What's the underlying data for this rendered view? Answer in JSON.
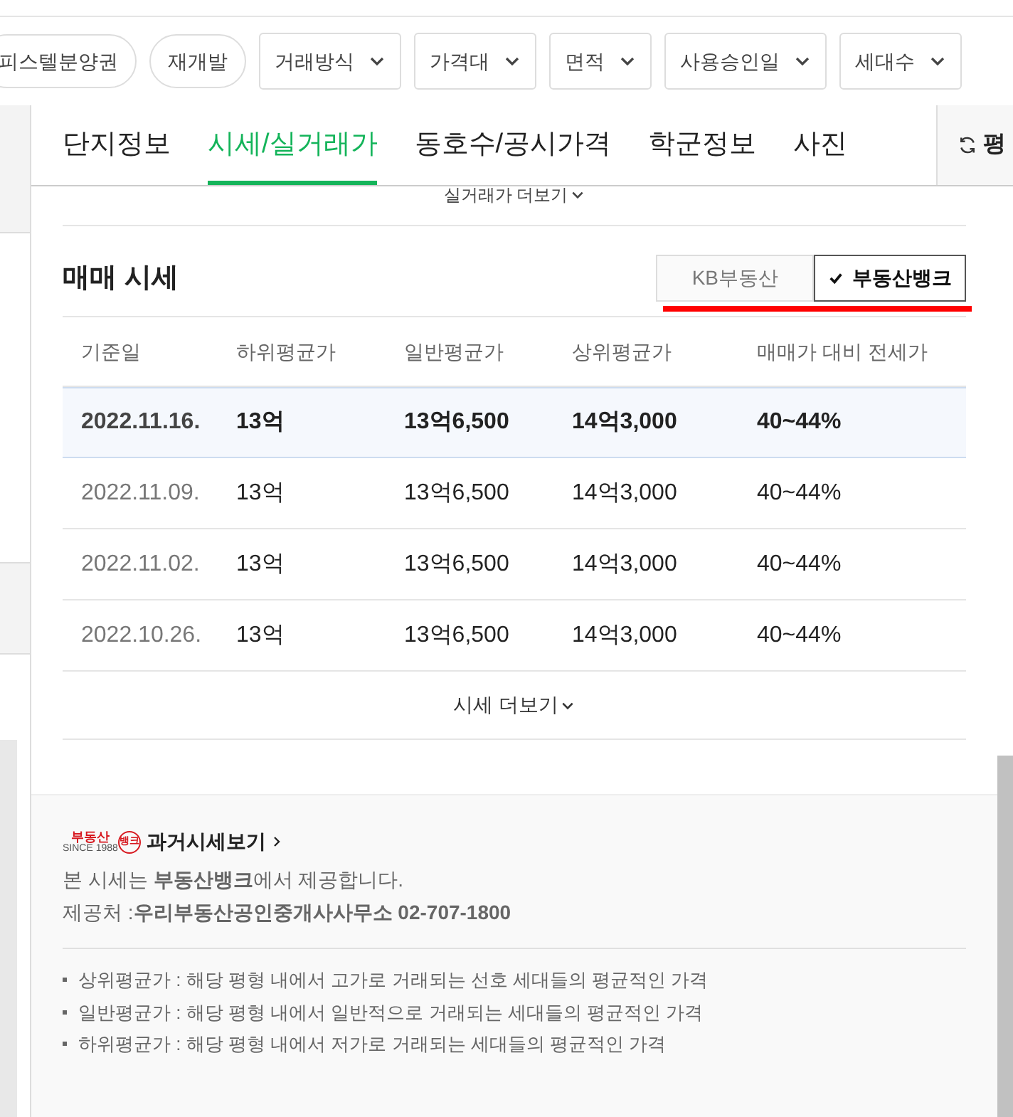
{
  "filters": [
    {
      "label": "피스텔분양권",
      "kind": "chip"
    },
    {
      "label": "재개발",
      "kind": "chip"
    },
    {
      "label": "거래방식",
      "kind": "dropdown"
    },
    {
      "label": "가격대",
      "kind": "dropdown"
    },
    {
      "label": "면적",
      "kind": "dropdown"
    },
    {
      "label": "사용승인일",
      "kind": "dropdown"
    },
    {
      "label": "세대수",
      "kind": "dropdown"
    }
  ],
  "tabs": [
    {
      "label": "단지정보",
      "selected": false
    },
    {
      "label": "시세/실거래가",
      "selected": true
    },
    {
      "label": "동호수/공시가격",
      "selected": false
    },
    {
      "label": "학군정보",
      "selected": false
    },
    {
      "label": "사진",
      "selected": false
    }
  ],
  "side_button": {
    "label": "평"
  },
  "more_trades": {
    "label": "실거래가 더보기"
  },
  "section": {
    "title": "매매 시세",
    "sources": [
      {
        "label": "KB부동산",
        "selected": false
      },
      {
        "label": "부동산뱅크",
        "selected": true
      }
    ]
  },
  "table": {
    "columns": [
      "기준일",
      "하위평균가",
      "일반평균가",
      "상위평균가",
      "매매가 대비 전세가"
    ],
    "rows": [
      {
        "cells": [
          "2022.11.16.",
          "13억",
          "13억6,500",
          "14억3,000",
          "40~44%"
        ],
        "selected": true
      },
      {
        "cells": [
          "2022.11.09.",
          "13억",
          "13억6,500",
          "14억3,000",
          "40~44%"
        ],
        "selected": false
      },
      {
        "cells": [
          "2022.11.02.",
          "13억",
          "13억6,500",
          "14억3,000",
          "40~44%"
        ],
        "selected": false
      },
      {
        "cells": [
          "2022.10.26.",
          "13억",
          "13억6,500",
          "14억3,000",
          "40~44%"
        ],
        "selected": false
      }
    ]
  },
  "more_prices": {
    "label": "시세 더보기"
  },
  "footer": {
    "logo": {
      "text": "부동산",
      "badge": "뱅크",
      "tagline": "SINCE 1988"
    },
    "history_link": "과거시세보기",
    "provided_by": "본 시세는 **부동산뱅크**에서 제공합니다.",
    "provider": "제공처 :**우리부동산공인중개사사무소 02-707-1800**",
    "notes": [
      "상위평균가 : 해당 평형 내에서 고가로 거래되는 선호 세대들의 평균적인 가격",
      "일반평균가 : 해당 평형 내에서 일반적으로 거래되는 세대들의 평균적인 가격",
      "하위평균가 : 해당 평형 내에서 저가로 거래되는 세대들의 평균적인 가격"
    ]
  }
}
